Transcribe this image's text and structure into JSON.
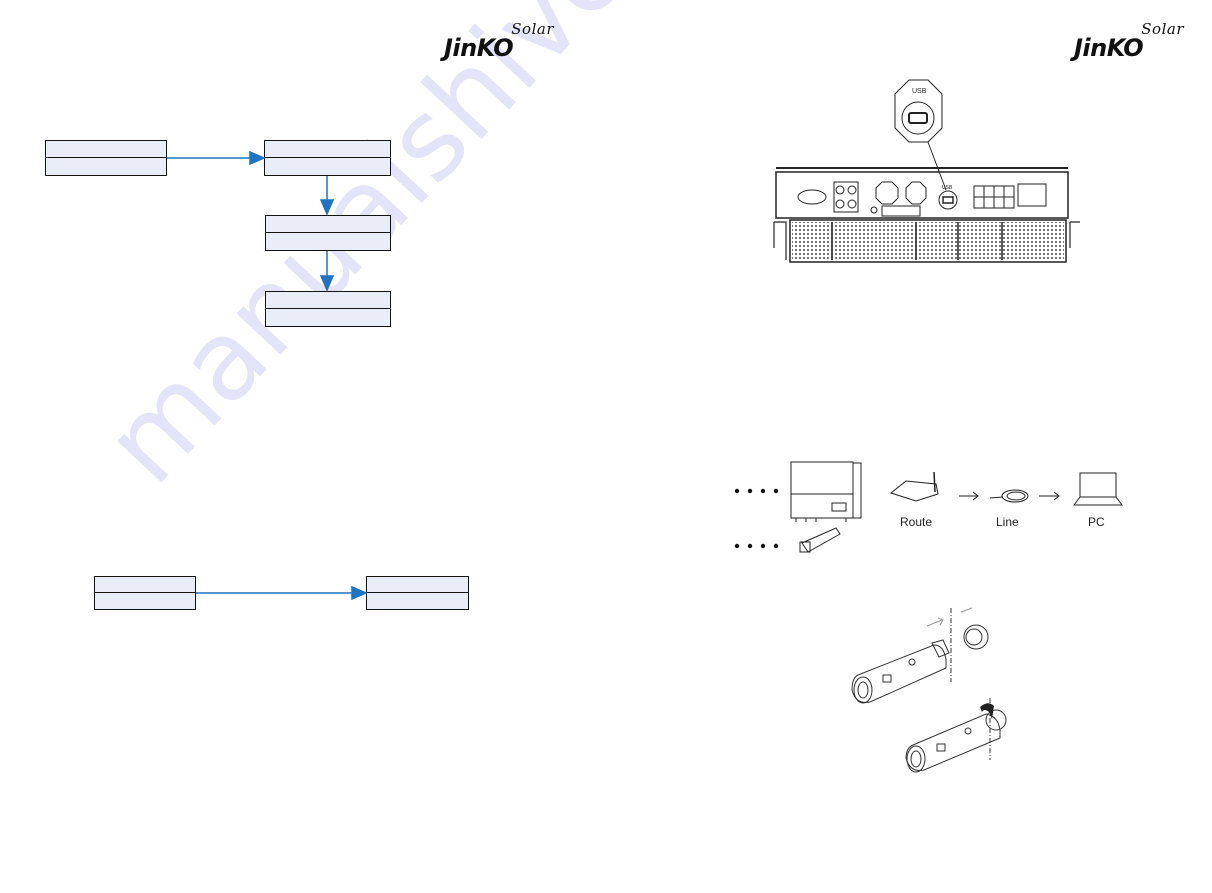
{
  "brand": {
    "logo_main": "JinKO",
    "logo_sub": "Solar"
  },
  "left_page": {
    "flow_top": {
      "boxes": [
        {
          "top": "",
          "bottom": ""
        },
        {
          "top": "",
          "bottom": ""
        },
        {
          "top": "",
          "bottom": ""
        },
        {
          "top": "",
          "bottom": ""
        }
      ],
      "arrow_color": "#1f73c0",
      "box_fill": "#e8edf7"
    },
    "flow_bottom": {
      "boxes": [
        {
          "top": "",
          "bottom": ""
        },
        {
          "top": "",
          "bottom": ""
        }
      ]
    }
  },
  "right_page": {
    "inverter_panel": {
      "callout_label": "USB",
      "port_label": "USB"
    },
    "network_diagram": {
      "labels": {
        "router": "Route",
        "line": "Line",
        "pc": "PC"
      },
      "arrow_glyph": "→"
    },
    "dongle_install": {
      "steps": 2
    }
  },
  "watermark": "manualshive.com"
}
